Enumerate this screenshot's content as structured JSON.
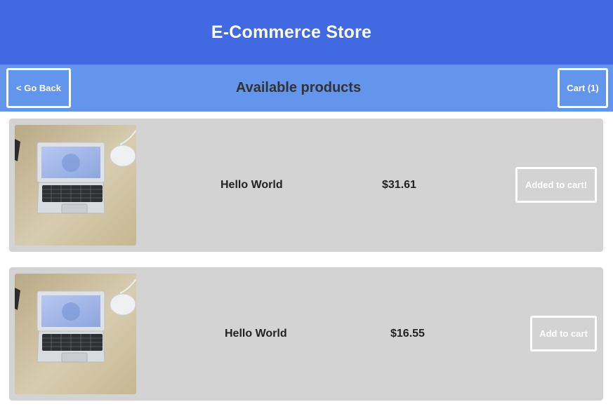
{
  "header": {
    "title": "E-Commerce Store"
  },
  "subbar": {
    "back_label": "< Go Back",
    "title": "Available products",
    "cart_label": "Cart (1)"
  },
  "products": [
    {
      "name": "Hello World",
      "price": "$31.61",
      "action_label": "Added to cart!",
      "image_icon": "laptop-photo"
    },
    {
      "name": "Hello World",
      "price": "$16.55",
      "action_label": "Add to cart",
      "image_icon": "laptop-photo"
    }
  ],
  "colors": {
    "header_bg": "#4169e1",
    "subbar_bg": "#6495ed",
    "card_bg": "#d3d3d3",
    "button_border": "#ffffff"
  }
}
